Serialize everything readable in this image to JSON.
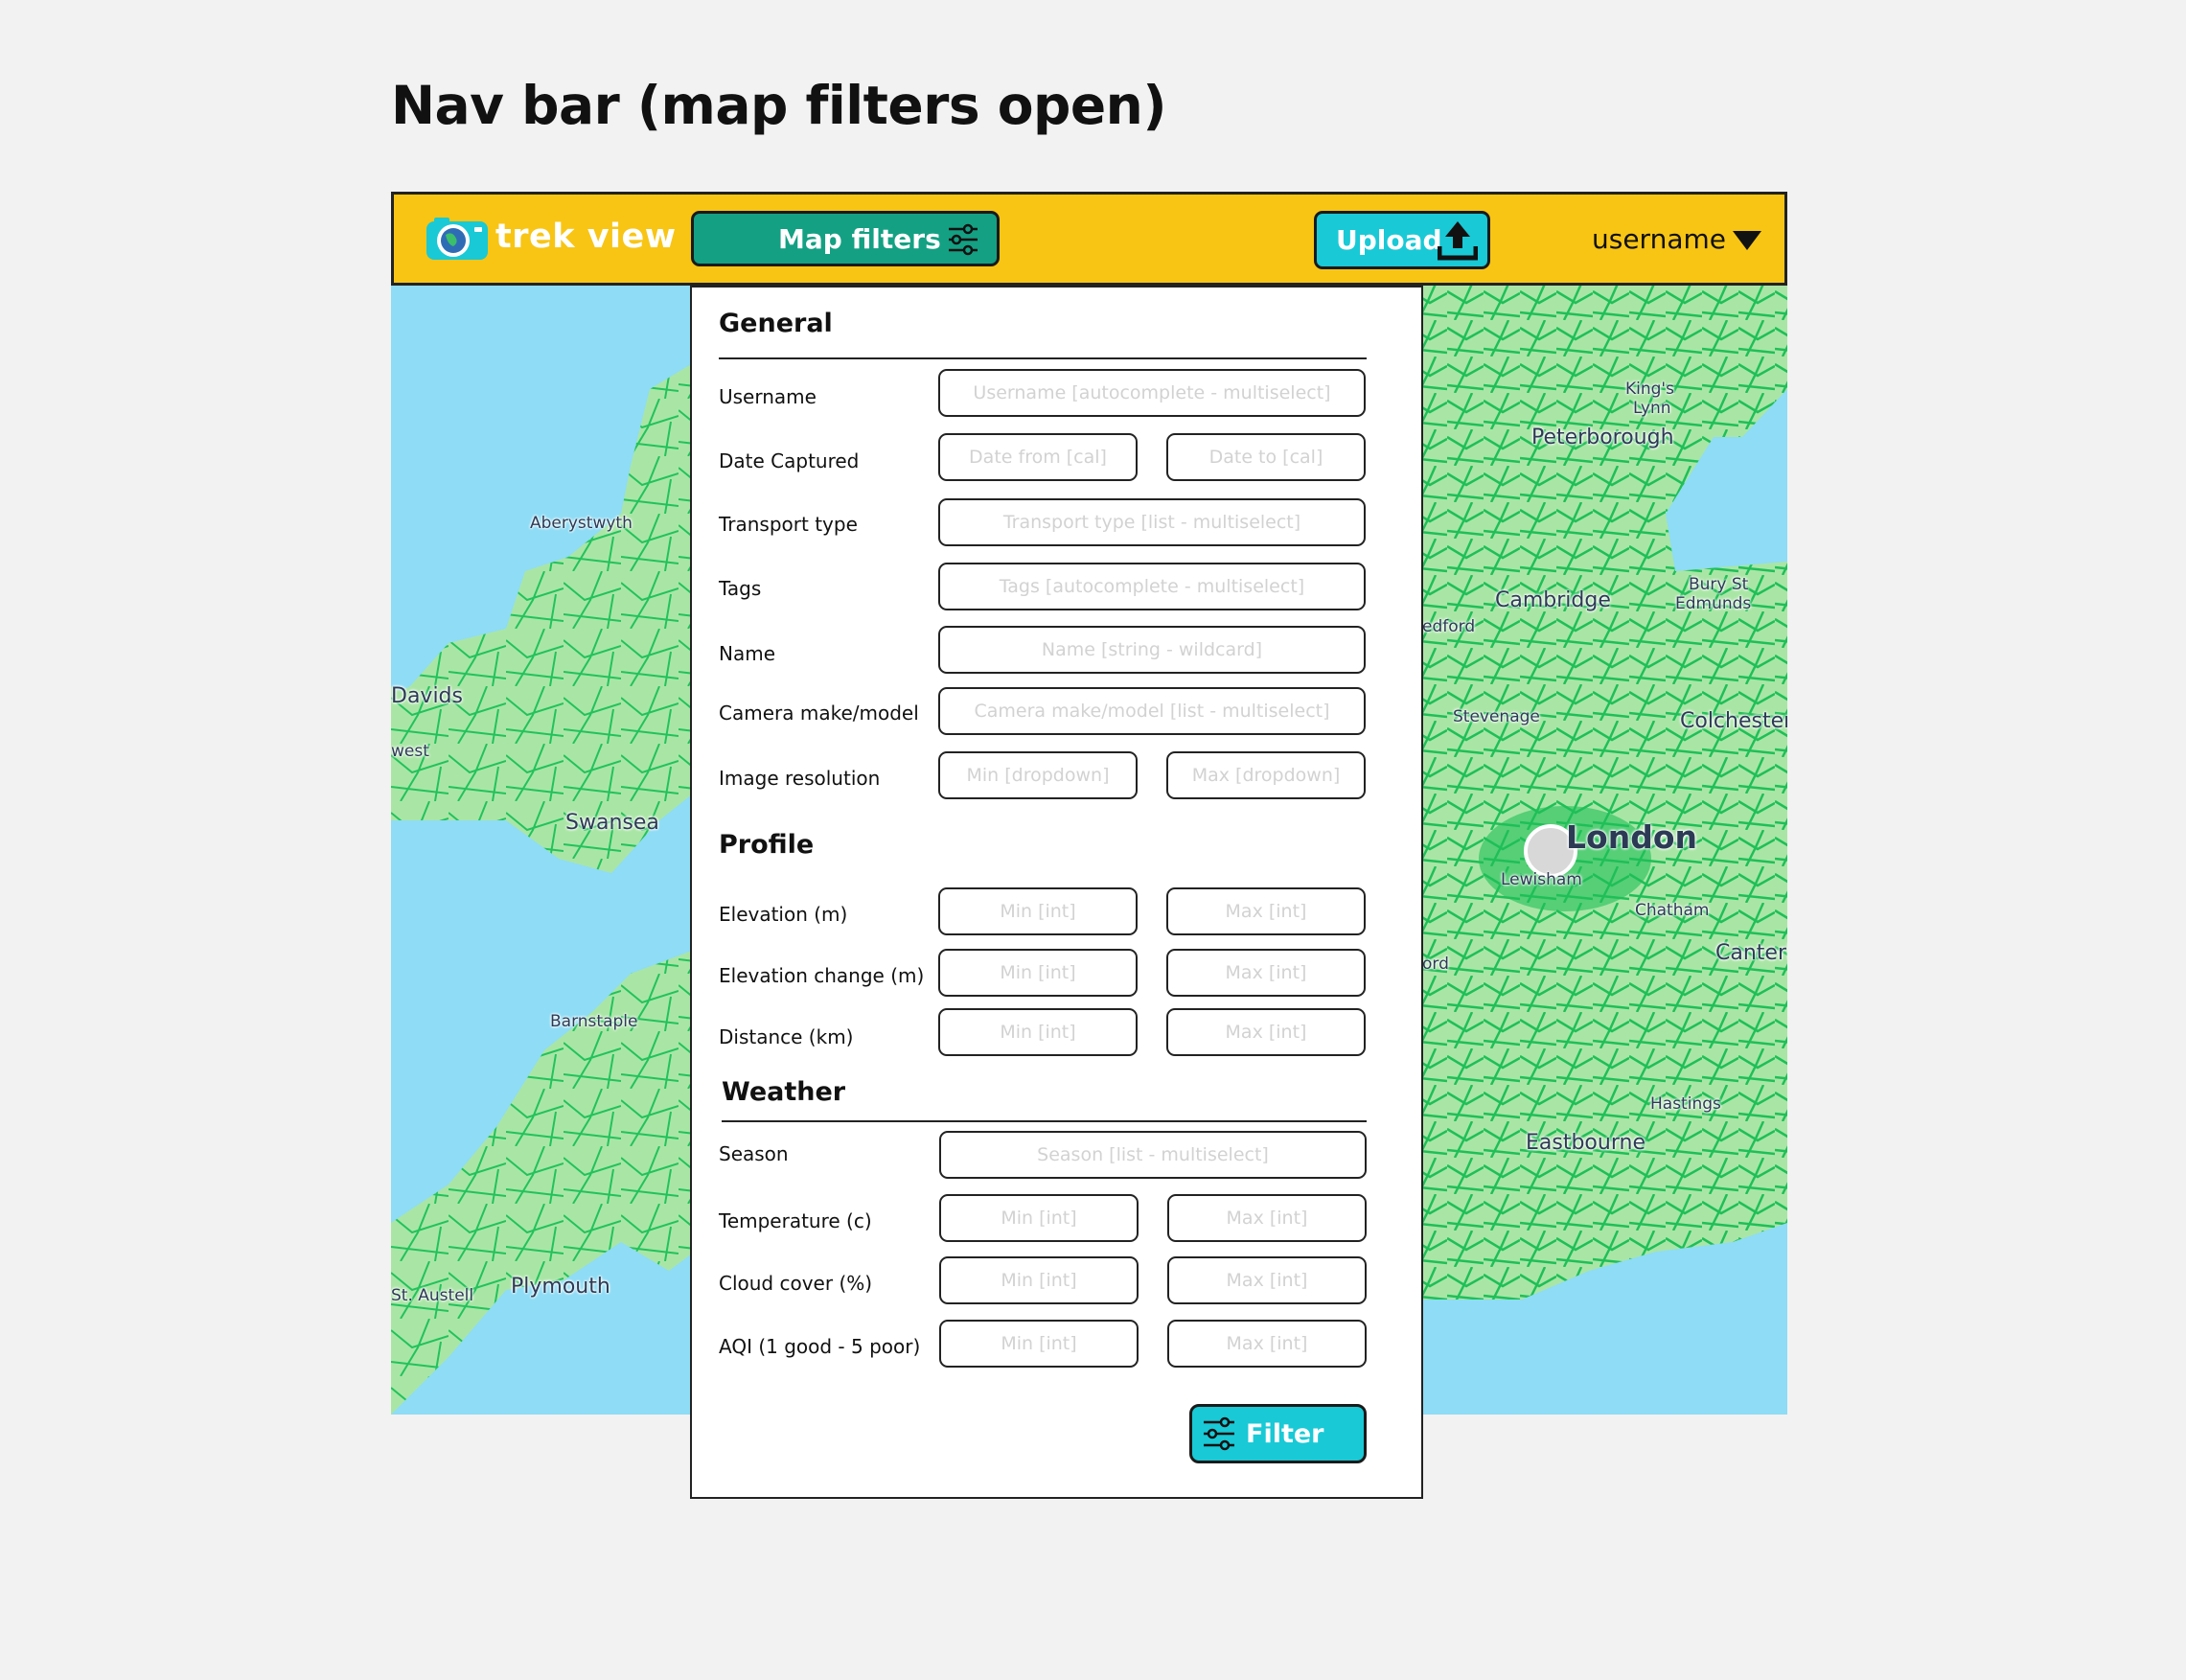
{
  "page": {
    "title": "Nav bar (map filters open)"
  },
  "navbar": {
    "brand": "trek view",
    "map_filters_label": "Map filters",
    "upload_label": "Upload",
    "username": "username",
    "colors": {
      "bar": "#f8c515",
      "filters_button": "#14a083",
      "upload_button": "#19c9d6"
    }
  },
  "map": {
    "labels": {
      "aberystwyth": "Aberystwyth",
      "davids": "Davids",
      "west": "west",
      "swansea": "Swansea",
      "barnstaple": "Barnstaple",
      "st_austell": "St. Austell",
      "plymouth": "Plymouth",
      "kings_lynn_1": "King's",
      "kings_lynn_2": "Lynn",
      "peterborough": "Peterborough",
      "cambridge": "Cambridge",
      "bury_1": "Bury St",
      "bury_2": "Edmunds",
      "bedford": "edford",
      "stevenage": "Stevenage",
      "colchester": "Colchester",
      "london": "London",
      "lewisham": "Lewisham",
      "chatham": "Chatham",
      "oxford": "ord",
      "canterbury": "Canterb",
      "hastings": "Hastings",
      "eastbourne": "Eastbourne"
    }
  },
  "filters": {
    "general": {
      "heading": "General",
      "username": {
        "label": "Username",
        "placeholder": "Username [autocomplete - multiselect]"
      },
      "date_captured": {
        "label": "Date Captured",
        "from_placeholder": "Date from [cal]",
        "to_placeholder": "Date to [cal]"
      },
      "transport_type": {
        "label": "Transport type",
        "placeholder": "Transport type [list - multiselect]"
      },
      "tags": {
        "label": "Tags",
        "placeholder": "Tags [autocomplete - multiselect]"
      },
      "name": {
        "label": "Name",
        "placeholder": "Name [string - wildcard]"
      },
      "camera": {
        "label": "Camera make/model",
        "placeholder": "Camera make/model [list - multiselect]"
      },
      "resolution": {
        "label": "Image resolution",
        "min_placeholder": "Min [dropdown]",
        "max_placeholder": "Max [dropdown]"
      }
    },
    "profile": {
      "heading": "Profile",
      "elevation": {
        "label": "Elevation (m)",
        "min_placeholder": "Min [int]",
        "max_placeholder": "Max [int]"
      },
      "elevation_change": {
        "label": "Elevation change (m)",
        "min_placeholder": "Min [int]",
        "max_placeholder": "Max [int]"
      },
      "distance": {
        "label": "Distance (km)",
        "min_placeholder": "Min [int]",
        "max_placeholder": "Max [int]"
      }
    },
    "weather": {
      "heading": "Weather",
      "season": {
        "label": "Season",
        "placeholder": "Season [list - multiselect]"
      },
      "temperature": {
        "label": "Temperature (c)",
        "min_placeholder": "Min [int]",
        "max_placeholder": "Max [int]"
      },
      "cloud_cover": {
        "label": "Cloud cover (%)",
        "min_placeholder": "Min [int]",
        "max_placeholder": "Max [int]"
      },
      "aqi": {
        "label": "AQI (1 good - 5 poor)",
        "min_placeholder": "Min [int]",
        "max_placeholder": "Max [int]"
      }
    },
    "submit_label": "Filter"
  }
}
